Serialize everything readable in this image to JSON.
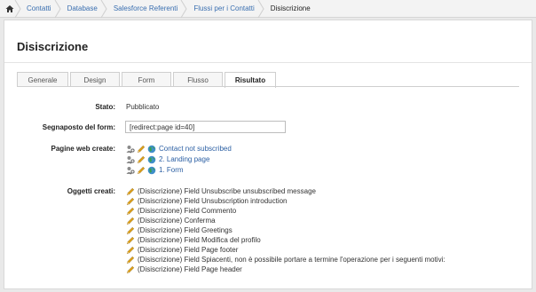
{
  "breadcrumb": {
    "items": [
      {
        "label": "Contatti"
      },
      {
        "label": "Database"
      },
      {
        "label": "Salesforce Referenti"
      },
      {
        "label": "Flussi per i Contatti"
      },
      {
        "label": "Disiscrizione"
      }
    ]
  },
  "page": {
    "title": "Disiscrizione"
  },
  "tabs": [
    {
      "label": "Generale",
      "active": false
    },
    {
      "label": "Design",
      "active": false
    },
    {
      "label": "Form",
      "active": false
    },
    {
      "label": "Flusso",
      "active": false
    },
    {
      "label": "Risultato",
      "active": true
    }
  ],
  "details": {
    "stato_label": "Stato:",
    "stato_value": "Pubblicato",
    "segnaposto_label": "Segnaposto del form:",
    "segnaposto_value": "[redirect:page id=40]",
    "pagine_label": "Pagine web create:",
    "oggetti_label": "Oggetti creati:"
  },
  "pages": [
    {
      "label": "Contact not subscribed"
    },
    {
      "label": "2. Landing page"
    },
    {
      "label": "1. Form"
    }
  ],
  "objects": [
    {
      "label": "(Disiscrizione) Field Unsubscribe unsubscribed message"
    },
    {
      "label": "(Disiscrizione) Field Unsubscription introduction"
    },
    {
      "label": "(Disiscrizione) Field Commento"
    },
    {
      "label": "(Disiscrizione) Conferma"
    },
    {
      "label": "(Disiscrizione) Field Greetings"
    },
    {
      "label": "(Disiscrizione) Field Modifica del profilo"
    },
    {
      "label": "(Disiscrizione) Field Page footer"
    },
    {
      "label": "(Disiscrizione) Field Spiacenti, non è possibile portare a termine l'operazione per i seguenti motivi:"
    },
    {
      "label": "(Disiscrizione) Field Page header"
    }
  ],
  "icons": {
    "home": "home-icon",
    "edit": "pencil-icon",
    "permissions": "key-user-icon",
    "preview": "globe-icon"
  },
  "colors": {
    "link": "#2b5fa3",
    "pencil": "#e0a21b",
    "globe": "#2f7d4a"
  }
}
